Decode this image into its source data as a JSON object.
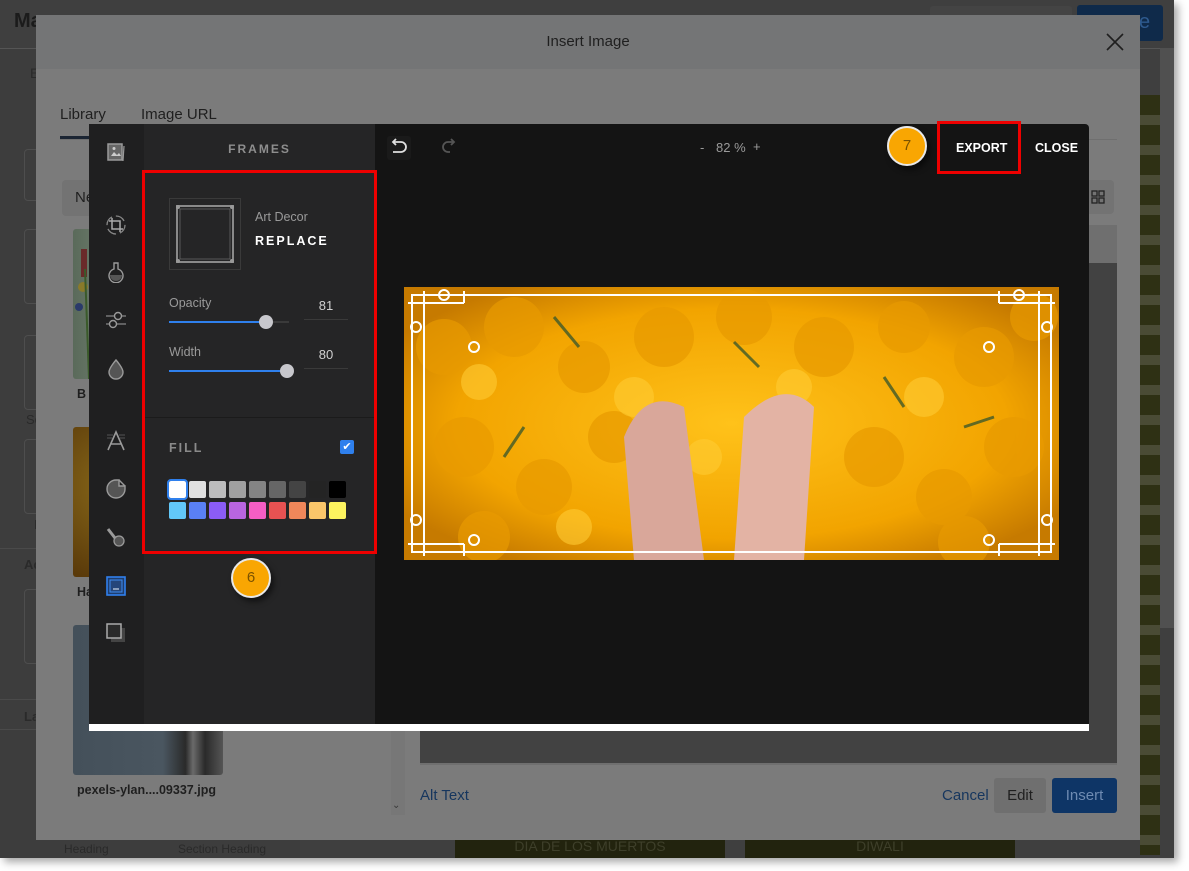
{
  "background_app": {
    "title": "Ma",
    "left_texts": [
      "E",
      "So",
      "D",
      "Ac",
      "La"
    ],
    "right_link_partial": "s",
    "top_button_partial": "e",
    "bottom_tiles": [
      "DIA DE LOS MUERTOS",
      "DIWALI"
    ],
    "footer_labels": [
      "Heading",
      "Section Heading"
    ]
  },
  "dialog": {
    "title": "Insert Image",
    "close_icon": "close-icon",
    "tabs": [
      {
        "label": "Library",
        "active": true
      },
      {
        "label": "Image URL",
        "active": false
      }
    ],
    "library_button_partial": "Ne",
    "library_items": [
      {
        "label": "B",
        "thumb": "tulips"
      },
      {
        "label": "Ha",
        "thumb": "marigolds"
      },
      {
        "label": "pexels-ylan....09337.jpg",
        "thumb": "pipe"
      }
    ],
    "footer": {
      "alt_text": "Alt Text",
      "cancel": "Cancel",
      "edit": "Edit",
      "insert": "Insert"
    }
  },
  "editor": {
    "rail_icons": [
      {
        "name": "library-icon",
        "active": false
      },
      {
        "name": "crop-icon",
        "active": false
      },
      {
        "name": "filter-icon",
        "active": false
      },
      {
        "name": "adjust-icon",
        "active": false
      },
      {
        "name": "focus-icon",
        "active": false
      },
      {
        "name": "text-icon",
        "active": false
      },
      {
        "name": "sticker-icon",
        "active": false
      },
      {
        "name": "brush-icon",
        "active": false
      },
      {
        "name": "frame-icon",
        "active": true
      },
      {
        "name": "overlay-icon",
        "active": false
      }
    ],
    "panel": {
      "title": "FRAMES",
      "frame_name": "Art Decor",
      "replace_label": "REPLACE",
      "opacity": {
        "label": "Opacity",
        "value": "81",
        "fraction": 0.81
      },
      "width": {
        "label": "Width",
        "value": "80",
        "fraction": 0.98
      },
      "fill": {
        "label": "FILL",
        "checked": true
      },
      "swatches_row1": [
        "#ffffff",
        "#e0e0e0",
        "#bdbdbd",
        "#a0a0a0",
        "#848484",
        "#666666",
        "#444444",
        "#242424",
        "#000000"
      ],
      "swatches_row2": [
        "#62c7f8",
        "#5a80f5",
        "#8b5cf6",
        "#b965e0",
        "#f55ec4",
        "#e85252",
        "#f0875a",
        "#fac66a",
        "#fdf45f"
      ],
      "selected_swatch": 0
    },
    "toolbar": {
      "zoom_minus": "-",
      "zoom_value": "82 %",
      "zoom_plus": "+",
      "export": "EXPORT",
      "close": "CLOSE"
    }
  },
  "annotations": [
    {
      "number": "6",
      "target": "frames-settings-panel"
    },
    {
      "number": "7",
      "target": "export-button"
    }
  ],
  "colors": {
    "accent": "#2f80ed",
    "highlight": "#ee0000",
    "badge": "#f9a602",
    "insert_button": "#0e3566"
  }
}
